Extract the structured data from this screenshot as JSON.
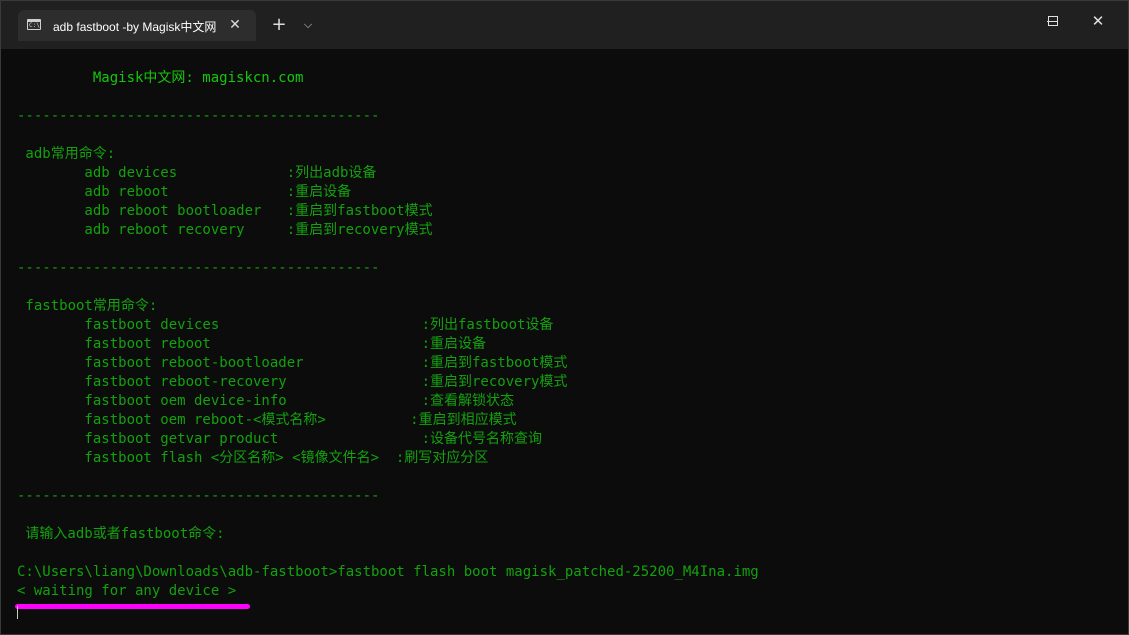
{
  "window": {
    "tab_title": "adb fastboot -by Magisk中文网",
    "tab_close": "✕",
    "new_tab": "+",
    "dropdown": "⌵",
    "minimize_icon": "minimize-icon",
    "maximize_icon": "maximize-icon",
    "close_icon": "✕"
  },
  "terminal": {
    "lines": [
      "         Magisk中文网: magiskcn.com",
      "",
      "-------------------------------------------",
      "",
      " adb常用命令:",
      "        adb devices             :列出adb设备",
      "        adb reboot              :重启设备",
      "        adb reboot bootloader   :重启到fastboot模式",
      "        adb reboot recovery     :重启到recovery模式",
      "",
      "-------------------------------------------",
      "",
      " fastboot常用命令:",
      "        fastboot devices                        :列出fastboot设备",
      "        fastboot reboot                         :重启设备",
      "        fastboot reboot-bootloader              :重启到fastboot模式",
      "        fastboot reboot-recovery                :重启到recovery模式",
      "        fastboot oem device-info                :查看解锁状态",
      "        fastboot oem reboot-<模式名称>          :重启到相应模式",
      "        fastboot getvar product                 :设备代号名称查询",
      "        fastboot flash <分区名称> <镜像文件名>  :刷写对应分区",
      "",
      "-------------------------------------------",
      "",
      " 请输入adb或者fastboot命令:",
      "",
      "C:\\Users\\liang\\Downloads\\adb-fastboot>fastboot flash boot magisk_patched-25200_M4Ina.img",
      "< waiting for any device >"
    ]
  },
  "colors": {
    "terminal_green": "#13a10e",
    "terminal_white": "#cccccc",
    "highlight": "#ff00ff",
    "background": "#0c0c0c"
  }
}
